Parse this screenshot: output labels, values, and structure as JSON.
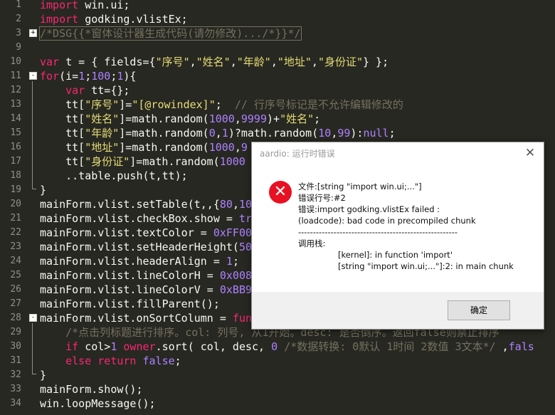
{
  "editor": {
    "lines": [
      {
        "n": "1",
        "html": "<span class=\"kw\">import</span> win.ui;"
      },
      {
        "n": "2",
        "html": "<span class=\"kw\">import</span> godking.vlistEx;"
      },
      {
        "n": "3",
        "html": "<span class=\"cmt boxed\">/*DSG{{*窗体设计器生成代码(请勿修改).../*}}*/</span>",
        "fold": "+"
      },
      {
        "n": "9",
        "html": ""
      },
      {
        "n": "10",
        "html": "<span class=\"kw\">var</span> t = { fields={<span class=\"str\">\"序号\"</span>,<span class=\"str\">\"姓名\"</span>,<span class=\"str\">\"年龄\"</span>,<span class=\"str\">\"地址\"</span>,<span class=\"str\">\"身份证\"</span>} };"
      },
      {
        "n": "11",
        "html": "<span class=\"kw\">for</span>(i=<span class=\"num\">1</span>;<span class=\"num\">100</span>;<span class=\"num\">1</span>){",
        "fold": "-"
      },
      {
        "n": "12",
        "html": "    <span class=\"kw\">var</span> tt={};"
      },
      {
        "n": "13",
        "html": "    tt[<span class=\"str\">\"序号\"</span>]=<span class=\"str\">\"[@rowindex]\"</span>;  <span class=\"cmt\">// 行序号标记是不允许编辑修改的</span>"
      },
      {
        "n": "14",
        "html": "    tt[<span class=\"str\">\"姓名\"</span>]=math.random(<span class=\"num\">1000</span>,<span class=\"num\">9999</span>)+<span class=\"str\">\"姓名\"</span>;"
      },
      {
        "n": "15",
        "html": "    tt[<span class=\"str\">\"年龄\"</span>]=math.random(<span class=\"num\">0</span>,<span class=\"num\">1</span>)?math.random(<span class=\"num\">10</span>,<span class=\"num\">99</span>):<span class=\"num\">null</span>;"
      },
      {
        "n": "16",
        "html": "    tt[<span class=\"str\">\"地址\"</span>]=math.random(<span class=\"num\">1000</span>,<span class=\"num\">9</span>"
      },
      {
        "n": "17",
        "html": "    tt[<span class=\"str\">\"身份证\"</span>]=math.random(<span class=\"num\">1000</span>"
      },
      {
        "n": "18",
        "html": "    ..table.push(t,tt);"
      },
      {
        "n": "19",
        "html": "}"
      },
      {
        "n": "20",
        "html": "mainForm.vlist.setTable(t,,{<span class=\"num\">80</span>,<span class=\"num\">10</span>"
      },
      {
        "n": "21",
        "html": "mainForm.vlist.checkBox.show = <span class=\"num\">tr</span>"
      },
      {
        "n": "22",
        "html": "mainForm.vlist.textColor = <span class=\"num\">0xFF00</span>"
      },
      {
        "n": "23",
        "html": "mainForm.vlist.setHeaderHeight(<span class=\"num\">50</span>"
      },
      {
        "n": "24",
        "html": "mainForm.vlist.headerAlign = <span class=\"num\">1</span>;"
      },
      {
        "n": "25",
        "html": "mainForm.vlist.lineColorH = <span class=\"num\">0x008</span>"
      },
      {
        "n": "26",
        "html": "mainForm.vlist.lineColorV = <span class=\"num\">0xBB9</span>"
      },
      {
        "n": "27",
        "html": "mainForm.vlist.fillParent();"
      },
      {
        "n": "28",
        "html": "mainForm.vlist.onSortColumn = <span class=\"kw\">fun</span>",
        "fold": "-"
      },
      {
        "n": "29",
        "html": "    <span class=\"cmt\">/*点击列标题进行排序。col: 列号, 从1开始。desc: 是否倒序。返回false则禁止排序</span>"
      },
      {
        "n": "30",
        "html": "    <span class=\"kw\">if</span> col&gt;<span class=\"num\">1</span> <span class=\"kw\">owner</span>.sort( col, desc, <span class=\"num\">0</span> <span class=\"cmt\">/*数据转换: 0默认 1时间 2数值 3文本*/</span> ,<span class=\"num\">fals</span>"
      },
      {
        "n": "31",
        "html": "    <span class=\"kw\">else</span> <span class=\"kw\">return</span> <span class=\"num\">false</span>;"
      },
      {
        "n": "32",
        "html": "}"
      },
      {
        "n": "33",
        "html": "mainForm.show();"
      },
      {
        "n": "34",
        "html": "win.loopMessage();"
      }
    ]
  },
  "dialog": {
    "title": "aardio: 运行时错误",
    "close_glyph": "✕",
    "icon_glyph": "✕",
    "file_line": "文件:[string \"import win.ui;...\"]",
    "error_line": "错误行号:#2",
    "error_msg": "错误:import godking.vlistEx failed :",
    "error_detail": "(loadcode): bad code in precompiled chunk",
    "separator": "------------------------------------------------------",
    "stack_label": "调用栈:",
    "stack_1": "[kernel]: in function 'import'",
    "stack_2": "[string \"import win.ui;...\"]:2: in main chunk",
    "ok_label": "确定"
  },
  "colors": {
    "editor_bg": "#272822",
    "keyword": "#f92672",
    "string": "#e6db74",
    "number": "#ae81ff",
    "comment": "#75715e",
    "error_icon": "#e81123"
  }
}
